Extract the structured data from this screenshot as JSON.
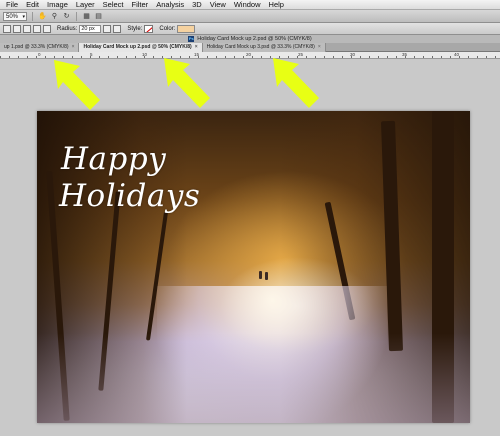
{
  "menu": {
    "items": [
      "File",
      "Edit",
      "Image",
      "Layer",
      "Select",
      "Filter",
      "Analysis",
      "3D",
      "View",
      "Window",
      "Help"
    ]
  },
  "app_bar": {
    "zoom_value": "50%",
    "icons": [
      "hand-icon",
      "zoom-icon",
      "rotate-icon",
      "grid-icon",
      "arrange-icon"
    ]
  },
  "options_bar": {
    "radius_label": "Radius:",
    "radius_value": "20 px",
    "style_label": "Style:",
    "color_label": "Color:",
    "color_value": "#f5d2a0"
  },
  "document": {
    "window_title": "Holiday Card Mock up 2.psd @ 50% (CMYK/8)",
    "ps_badge": "Ps"
  },
  "tabs": [
    {
      "label": "up 1.psd @ 33.3% (CMYK/8)",
      "close": "×",
      "active": false
    },
    {
      "label": "Holiday Card Mock up 2.psd @ 50% (CMYK/8)",
      "close": "×",
      "active": true
    },
    {
      "label": "Holiday Card Mock up 3.psd @ 33.3% (CMYK/8)",
      "close": "×",
      "active": false
    }
  ],
  "ruler": {
    "labels": [
      "0",
      "5",
      "10",
      "15",
      "20",
      "25",
      "30",
      "35",
      "40"
    ]
  },
  "card": {
    "line1": "Happy",
    "line2": "Holidays"
  },
  "annotations": {
    "arrow_color": "#e8ff14"
  }
}
